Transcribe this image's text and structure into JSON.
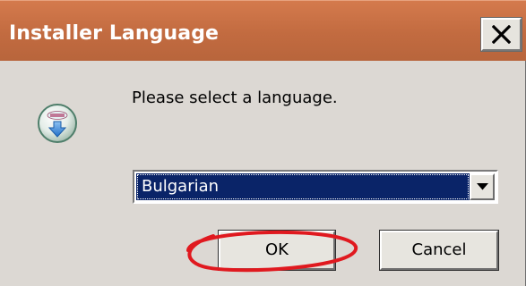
{
  "window": {
    "title": "Installer Language"
  },
  "dialog": {
    "prompt": "Please select a language.",
    "language_select": {
      "selected": "Bulgarian"
    },
    "buttons": {
      "ok_label": "OK",
      "cancel_label": "Cancel"
    }
  },
  "icons": {
    "app": "nsis-installer-icon",
    "close": "close-icon",
    "dropdown": "chevron-down-icon"
  },
  "annotation": {
    "highlight_target": "ok-button",
    "highlight_color": "#e0191f"
  },
  "colors": {
    "titlebar": "#c26b40",
    "client_background": "#dcd8d3",
    "selection": "#0a2468"
  }
}
